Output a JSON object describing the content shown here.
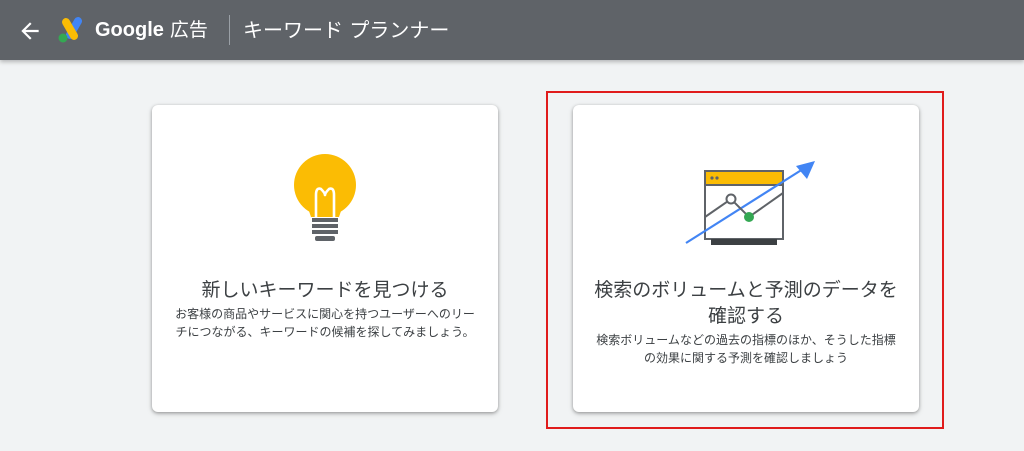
{
  "header": {
    "brand": "Google",
    "product": "広告",
    "tool_title": "キーワード プランナー"
  },
  "icons": {
    "back": "arrow-back-icon",
    "logo": "google-ads-logo-icon",
    "bulb": "lightbulb-icon",
    "chart": "trend-chart-icon"
  },
  "colors": {
    "topbar": "#5f6368",
    "highlight": "#e01b1b",
    "bulb": "#fbbc04",
    "chart_arrow": "#4285f4",
    "chart_point": "#34a853"
  },
  "cards": {
    "find": {
      "title": "新しいキーワードを見つける",
      "description": "お客様の商品やサービスに関心を持つユーザーへのリーチにつながる、キーワードの候補を探してみましょう。"
    },
    "forecast": {
      "title": "検索のボリュームと予測のデータを確認する",
      "description": "検索ボリュームなどの過去の指標のほか、そうした指標の効果に関する予測を確認しましょう"
    }
  }
}
